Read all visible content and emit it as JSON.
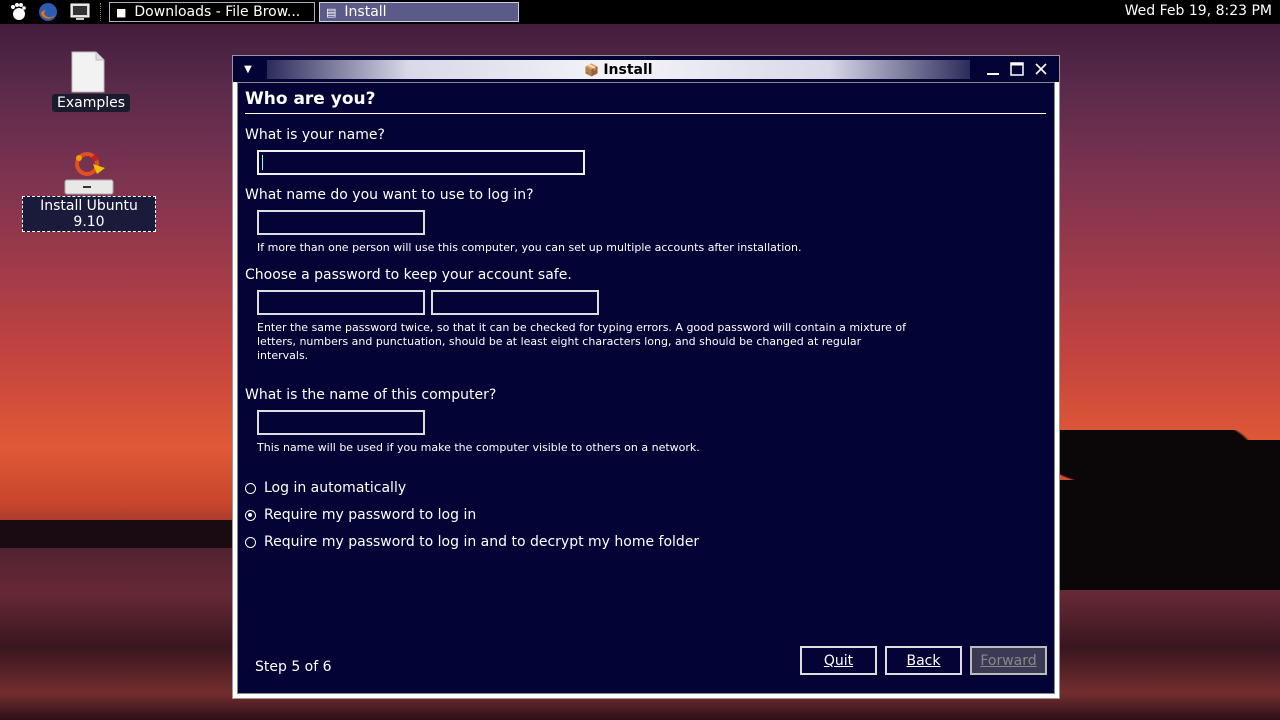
{
  "panel": {
    "tasks": [
      {
        "label": "Downloads - File Brow...",
        "icon": "folder-icon",
        "active": false
      },
      {
        "label": "Install",
        "icon": "installer-icon",
        "active": true
      }
    ],
    "clock": "Wed Feb 19,  8:23 PM"
  },
  "desktop": {
    "icons": [
      {
        "label": "Examples",
        "icon": "document-icon"
      },
      {
        "label": "Install Ubuntu 9.10",
        "icon": "install-icon"
      }
    ]
  },
  "window": {
    "title": "Install",
    "heading": "Who are you?",
    "q_name": "What is your name?",
    "q_login": "What name do you want to use to log in?",
    "hint_login": "If more than one person will use this computer, you can set up multiple accounts after installation.",
    "q_password": "Choose a password to keep your account safe.",
    "hint_password": "Enter the same password twice, so that it can be checked for typing errors. A good password will contain a mixture of letters, numbers and punctuation, should be at least eight characters long, and should be changed at regular intervals.",
    "q_computer": "What is the name of this computer?",
    "hint_computer": "This name will be used if you make the computer visible to others on a network.",
    "fields": {
      "name": "",
      "login": "",
      "password": "",
      "password_confirm": "",
      "computer": ""
    },
    "options": [
      {
        "label": "Log in automatically",
        "selected": false
      },
      {
        "label": "Require my password to log in",
        "selected": true
      },
      {
        "label": "Require my password to log in and to decrypt my home folder",
        "selected": false
      }
    ],
    "step": "Step 5 of 6",
    "buttons": {
      "quit": "Quit",
      "back": "Back",
      "forward": "Forward"
    }
  }
}
